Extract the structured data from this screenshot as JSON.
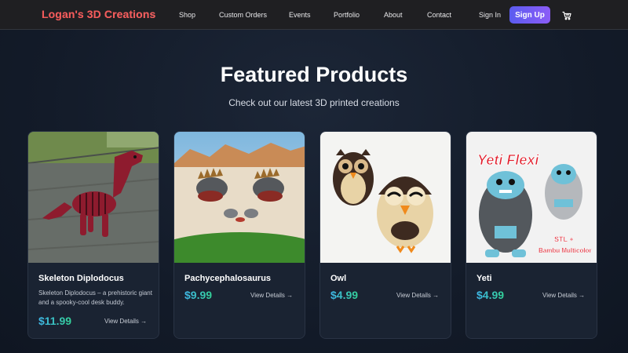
{
  "nav": {
    "brand": "Logan's 3D Creations",
    "links": [
      "Shop",
      "Custom Orders",
      "Events",
      "Portfolio",
      "About",
      "Contact"
    ],
    "sign_in": "Sign In",
    "sign_up": "Sign Up",
    "cart_icon": "cart-icon"
  },
  "hero": {
    "title": "Featured Products",
    "subtitle": "Check out our latest 3D printed creations"
  },
  "products": [
    {
      "name": "Skeleton Diplodocus",
      "description": "Skeleton Diplodocus – a prehistoric giant and a spooky-cool desk buddy.",
      "price": "$11.99",
      "details_label": "View Details →"
    },
    {
      "name": "Pachycephalosaurus",
      "description": "",
      "price": "$9.99",
      "details_label": "View Details →"
    },
    {
      "name": "Owl",
      "description": "",
      "price": "$4.99",
      "details_label": "View Details →"
    },
    {
      "name": "Yeti",
      "description": "",
      "price": "$4.99",
      "details_label": "View Details →",
      "image_text": [
        "Yeti Flexi",
        "STL +",
        "Bambu Multicolor"
      ]
    }
  ],
  "colors": {
    "background": "#131b29",
    "nav": "#1f1f22",
    "brand": "#f05a5a",
    "signup_start": "#5b5cf0",
    "signup_end": "#8b5cf6",
    "price_start": "#3fb6e8",
    "price_end": "#34d399",
    "card": "#1a2332"
  }
}
